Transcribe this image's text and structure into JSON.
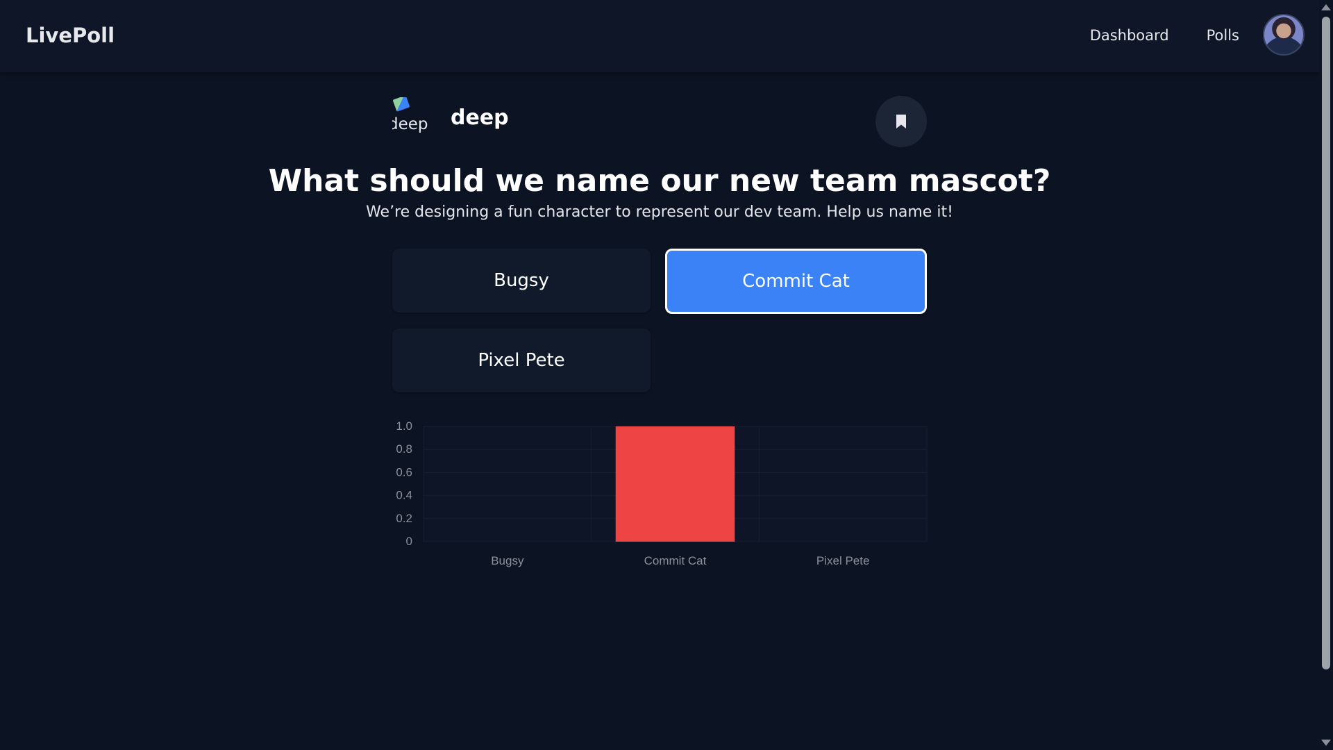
{
  "app": {
    "brand": "LivePoll"
  },
  "nav": {
    "links": [
      "Dashboard",
      "Polls"
    ]
  },
  "poll": {
    "author": "deep",
    "author_image_alt": "deep",
    "title": "What should we name our new team mascot?",
    "description": "We’re designing a fun character to represent our dev team. Help us name it!",
    "options": [
      {
        "label": "Bugsy",
        "selected": false
      },
      {
        "label": "Commit Cat",
        "selected": true
      },
      {
        "label": "Pixel Pete",
        "selected": false
      }
    ]
  },
  "icons": {
    "bookmark": "bookmark-icon",
    "avatar": "user-avatar"
  },
  "colors": {
    "background": "#0c1322",
    "selected_option": "#3b82f6",
    "bar": "#ef4444"
  },
  "chart_data": {
    "type": "bar",
    "categories": [
      "Bugsy",
      "Commit Cat",
      "Pixel Pete"
    ],
    "values": [
      0,
      1,
      0
    ],
    "yticks": [
      "0",
      "0.2",
      "0.4",
      "0.6",
      "0.8",
      "1.0"
    ],
    "ylim": [
      0,
      1
    ],
    "grid": true,
    "legend": "none"
  }
}
